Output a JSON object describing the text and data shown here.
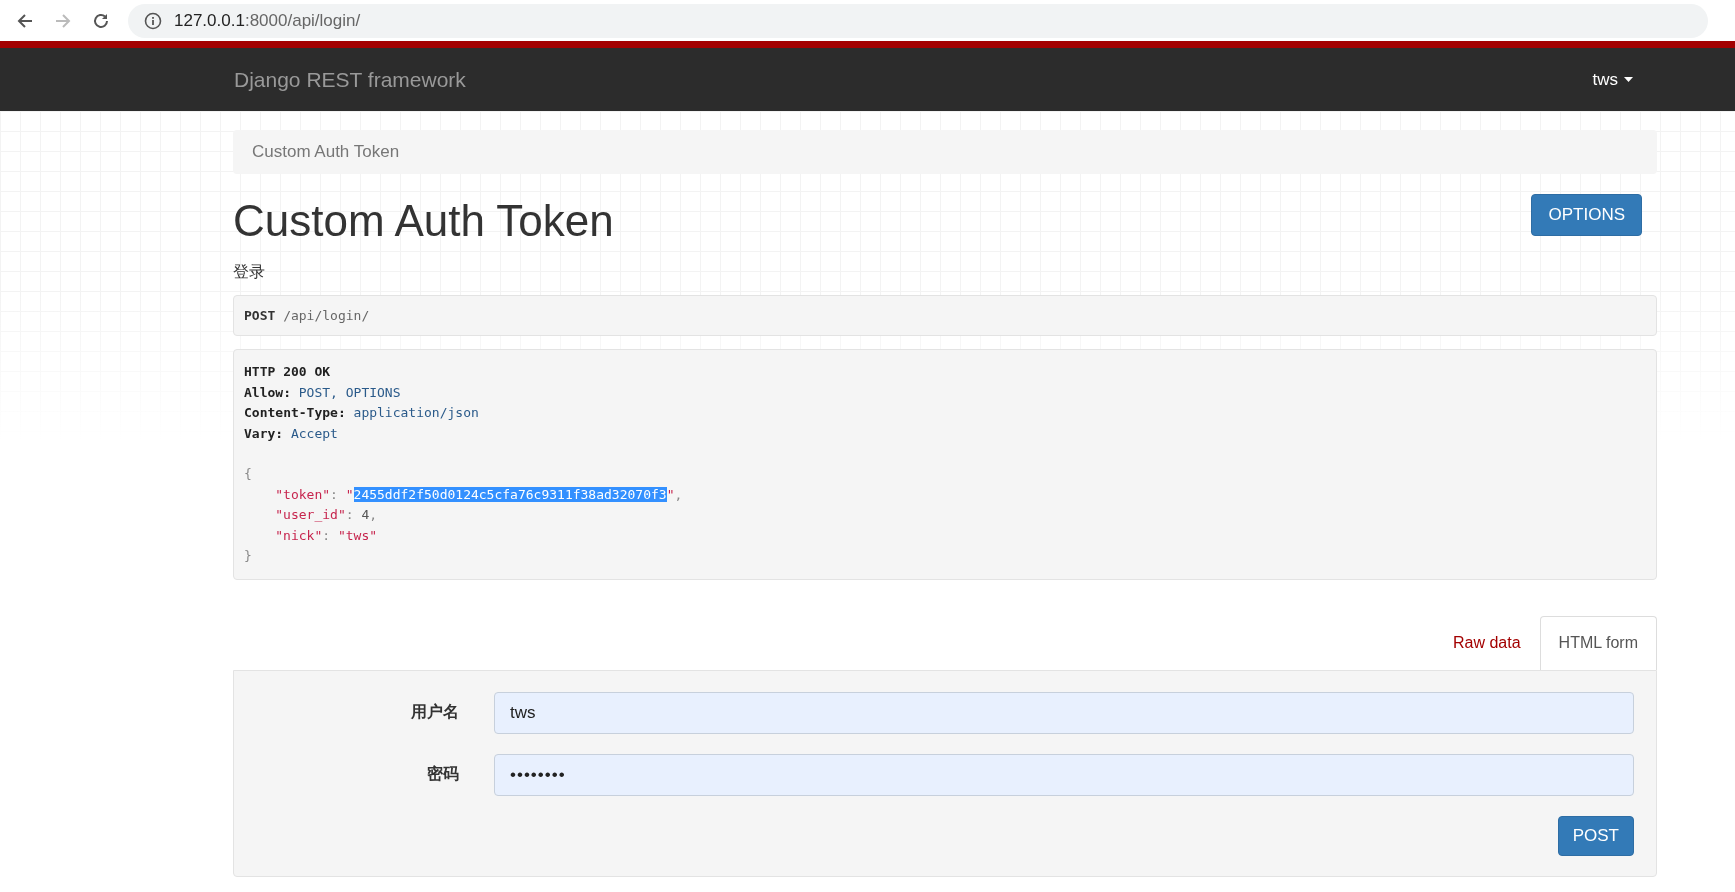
{
  "browser": {
    "url_host": "127.0.0.1",
    "url_rest": ":8000/api/login/",
    "back_disabled": false,
    "forward_disabled": true
  },
  "navbar": {
    "brand": "Django REST framework",
    "user": "tws"
  },
  "breadcrumb": [
    "Custom Auth Token"
  ],
  "page": {
    "title": "Custom Auth Token",
    "options_button": "OPTIONS",
    "description": "登录"
  },
  "request": {
    "method": "POST",
    "path": "/api/login/"
  },
  "response": {
    "lines": [
      {
        "indent": false,
        "gap_before": false,
        "parts": [
          {
            "kind": "header",
            "text": "HTTP 200 OK"
          }
        ]
      },
      {
        "indent": false,
        "gap_before": false,
        "parts": [
          {
            "kind": "header",
            "text": "Allow:"
          },
          {
            "kind": "value",
            "text": "POST, OPTIONS"
          }
        ]
      },
      {
        "indent": false,
        "gap_before": false,
        "parts": [
          {
            "kind": "header",
            "text": "Content-Type:"
          },
          {
            "kind": "value",
            "text": "application/json"
          }
        ]
      },
      {
        "indent": false,
        "gap_before": false,
        "parts": [
          {
            "kind": "header",
            "text": "Vary:"
          },
          {
            "kind": "value",
            "text": "Accept"
          }
        ]
      },
      {
        "indent": false,
        "gap_before": true,
        "parts": [
          {
            "kind": "punct",
            "text": "{"
          }
        ]
      },
      {
        "indent": true,
        "gap_before": false,
        "parts": [
          {
            "kind": "key",
            "text": "\"token\""
          },
          {
            "kind": "colon",
            "text": ":"
          },
          {
            "kind": "string",
            "text": "\""
          },
          {
            "kind": "selection",
            "text": "2455ddf2f50d0124c5cfa76c9311f38ad32070f3"
          },
          {
            "kind": "string",
            "text": "\""
          },
          {
            "kind": "punct",
            "text": ","
          }
        ]
      },
      {
        "indent": true,
        "gap_before": false,
        "parts": [
          {
            "kind": "key",
            "text": "\"user_id\""
          },
          {
            "kind": "colon",
            "text": ":"
          },
          {
            "kind": "number",
            "text": "4"
          },
          {
            "kind": "punct",
            "text": ","
          }
        ]
      },
      {
        "indent": true,
        "gap_before": false,
        "parts": [
          {
            "kind": "key",
            "text": "\"nick\""
          },
          {
            "kind": "colon",
            "text": ":"
          },
          {
            "kind": "string",
            "text": "\"tws\""
          }
        ]
      },
      {
        "indent": false,
        "gap_before": false,
        "parts": [
          {
            "kind": "punct",
            "text": "}"
          }
        ]
      }
    ]
  },
  "tabs": [
    {
      "label": "Raw data",
      "selected": false
    },
    {
      "label": "HTML form",
      "selected": true
    }
  ],
  "form": {
    "fields": [
      {
        "label": "用户名",
        "value": "tws",
        "kind": "text"
      },
      {
        "label": "密码",
        "value": "••••••••",
        "kind": "password"
      }
    ],
    "submit": "POST"
  }
}
